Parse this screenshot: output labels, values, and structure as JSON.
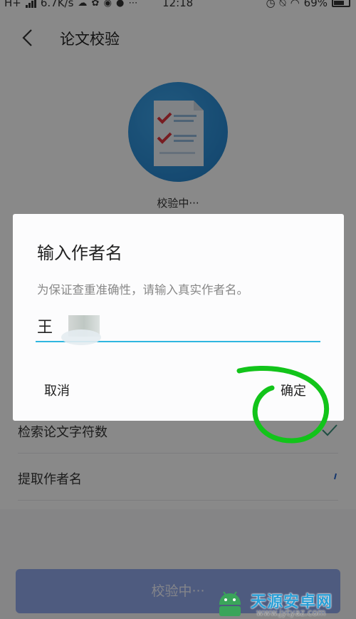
{
  "status_bar": {
    "network": "H+",
    "speed": "6.7K/s",
    "time": "12:18",
    "battery": "69%",
    "battery_level": 0.69
  },
  "nav": {
    "title": "论文校验",
    "back_icon": "chevron-left-icon"
  },
  "verify": {
    "status": "校验中···",
    "icon": "checklist-document-icon",
    "circle_color": "#2a8ed8"
  },
  "list": {
    "items": [
      {
        "label": "检索论文字符数",
        "done": true
      },
      {
        "label": "提取作者名",
        "done": false
      }
    ]
  },
  "bottom_button": {
    "label": "校验中···",
    "color": "#8fa6e8"
  },
  "dialog": {
    "title": "输入作者名",
    "hint": "为保证查重准确性，请输入真实作者名。",
    "input_value": "王",
    "cancel_label": "取消",
    "confirm_label": "确定",
    "accent_color": "#2fb6e0"
  },
  "annotation": {
    "shape": "green-circle-around-confirm",
    "color": "#12c41a"
  },
  "watermark": {
    "brand": "天源安卓网",
    "url": "www.jytyaz.com"
  }
}
